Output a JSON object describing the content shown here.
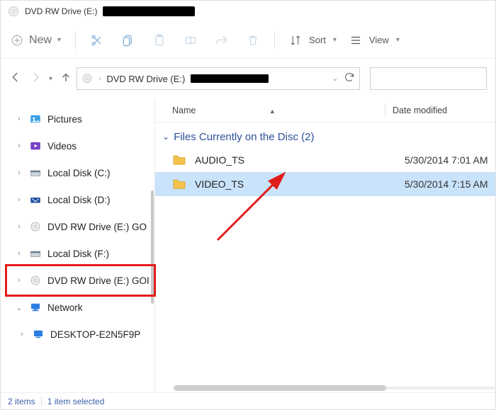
{
  "titlebar": {
    "title": "DVD RW Drive (E:)"
  },
  "toolbar": {
    "new_label": "New",
    "sort_label": "Sort",
    "view_label": "View"
  },
  "addressbar": {
    "crumb1": "DVD RW Drive (E:)"
  },
  "sidebar": {
    "items": [
      {
        "label": "Pictures",
        "icon": "pictures"
      },
      {
        "label": "Videos",
        "icon": "videos"
      },
      {
        "label": "Local Disk (C:)",
        "icon": "disk"
      },
      {
        "label": "Local Disk (D:)",
        "icon": "disk-blue"
      },
      {
        "label": "DVD RW Drive (E:) GO",
        "icon": "dvd"
      },
      {
        "label": "Local Disk (F:)",
        "icon": "disk"
      },
      {
        "label": "DVD RW Drive (E:) GOI",
        "icon": "dvd",
        "boxed": true
      },
      {
        "label": "Network",
        "icon": "network",
        "expand": "down"
      },
      {
        "label": "DESKTOP-E2N5F9P",
        "icon": "pc",
        "child": true
      }
    ]
  },
  "columns": {
    "name": "Name",
    "date": "Date modified"
  },
  "group": {
    "header": "Files Currently on the Disc (2)"
  },
  "rows": [
    {
      "name": "AUDIO_TS",
      "date": "5/30/2014 7:01 AM",
      "selected": false
    },
    {
      "name": "VIDEO_TS",
      "date": "5/30/2014 7:15 AM",
      "selected": true
    }
  ],
  "status": {
    "count": "2 items",
    "sel": "1 item selected"
  }
}
